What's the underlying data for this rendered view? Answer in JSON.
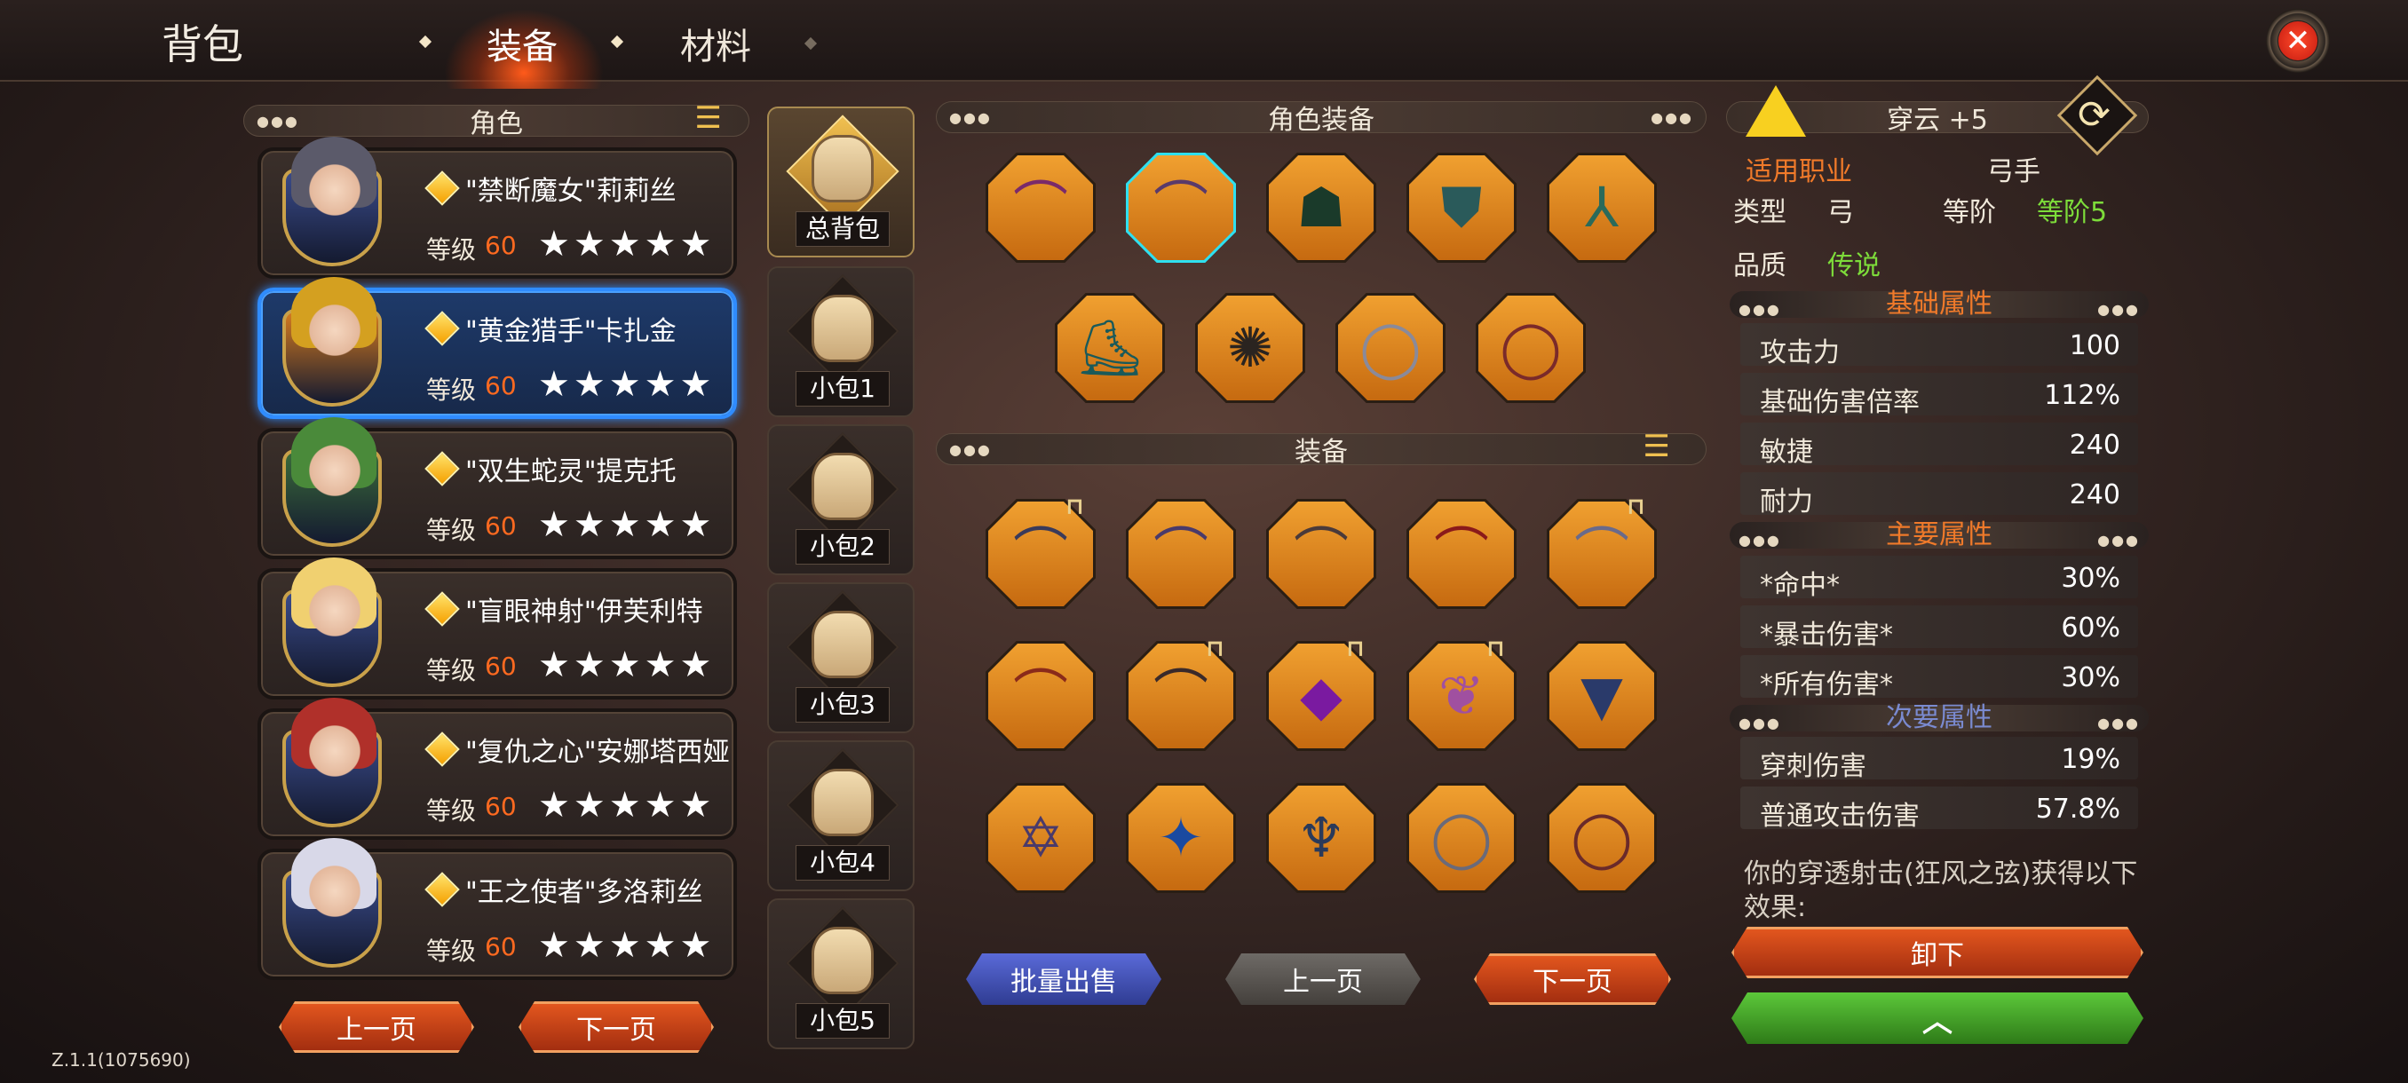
{
  "header": {
    "title": "背包",
    "tabs": [
      {
        "label": "装备",
        "active": true
      },
      {
        "label": "材料",
        "active": false
      }
    ]
  },
  "roles": {
    "header": "角色",
    "list": [
      {
        "name": "\"禁断魔女\"莉莉丝",
        "level_label": "等级",
        "level": "60",
        "stars": "★★★★★",
        "selected": false,
        "hair": "#5b5a6a",
        "shield": "#3a4b8a"
      },
      {
        "name": "\"黄金猎手\"卡扎金",
        "level_label": "等级",
        "level": "60",
        "stars": "★★★★★",
        "selected": true,
        "hair": "#d4a020",
        "shield": "#d47a20"
      },
      {
        "name": "\"双生蛇灵\"提克托",
        "level_label": "等级",
        "level": "60",
        "stars": "★★★★★",
        "selected": false,
        "hair": "#4a8a3a",
        "shield": "#3a6a3a"
      },
      {
        "name": "\"盲眼神射\"伊芙利特",
        "level_label": "等级",
        "level": "60",
        "stars": "★★★★★",
        "selected": false,
        "hair": "#f0d070",
        "shield": "#3a4b8a"
      },
      {
        "name": "\"复仇之心\"安娜塔西娅",
        "level_label": "等级",
        "level": "60",
        "stars": "★★★★★",
        "selected": false,
        "hair": "#b0302a",
        "shield": "#3a4b8a"
      },
      {
        "name": "\"王之使者\"多洛莉丝",
        "level_label": "等级",
        "level": "60",
        "stars": "★★★★★",
        "selected": false,
        "hair": "#d8d8e8",
        "shield": "#3a4b8a"
      }
    ],
    "prev_label": "上一页",
    "next_label": "下一页"
  },
  "bags": [
    {
      "label": "总背包",
      "active": true
    },
    {
      "label": "小包1",
      "active": false
    },
    {
      "label": "小包2",
      "active": false
    },
    {
      "label": "小包3",
      "active": false
    },
    {
      "label": "小包4",
      "active": false
    },
    {
      "label": "小包5",
      "active": false
    }
  ],
  "role_equipment": {
    "header": "角色装备",
    "row1": [
      {
        "icon": "bow-icon",
        "glyph": "⌒",
        "color": "#7a2a6a",
        "selected": false
      },
      {
        "icon": "bow-icon",
        "glyph": "⌒",
        "color": "#5a3a6a",
        "selected": true
      },
      {
        "icon": "hood-icon",
        "glyph": "☗",
        "color": "#1a3a2a",
        "selected": false
      },
      {
        "icon": "armor-icon",
        "glyph": "⛊",
        "color": "#2a5a5a",
        "selected": false
      },
      {
        "icon": "leggings-icon",
        "glyph": "⅄",
        "color": "#2a6a5a",
        "selected": false
      }
    ],
    "row2": [
      {
        "icon": "boots-icon",
        "glyph": "⛸",
        "color": "#1a5a5a",
        "selected": false
      },
      {
        "icon": "amulet-icon",
        "glyph": "✺",
        "color": "#2a2420",
        "selected": false
      },
      {
        "icon": "ring-icon",
        "glyph": "◯",
        "color": "#8a8a9a",
        "selected": false
      },
      {
        "icon": "ring-icon",
        "glyph": "◯",
        "color": "#7a2a2a",
        "selected": false
      }
    ]
  },
  "equipment": {
    "header": "装备",
    "items": [
      {
        "icon": "bow-icon",
        "glyph": "⌒",
        "color": "#3a3a5a",
        "locked": true
      },
      {
        "icon": "bow-icon",
        "glyph": "⌒",
        "color": "#4a3a6a",
        "locked": false
      },
      {
        "icon": "bow-icon",
        "glyph": "⌒",
        "color": "#4a3a3a",
        "locked": false
      },
      {
        "icon": "bow-icon",
        "glyph": "⌒",
        "color": "#8a1a1a",
        "locked": false
      },
      {
        "icon": "bow-icon",
        "glyph": "⌒",
        "color": "#6a6a8a",
        "locked": true
      },
      {
        "icon": "bow-icon",
        "glyph": "⌒",
        "color": "#8a2a1a",
        "locked": false
      },
      {
        "icon": "bow-icon",
        "glyph": "⌒",
        "color": "#3a2a2a",
        "locked": true
      },
      {
        "icon": "amulet-icon",
        "glyph": "◆",
        "color": "#7a1aa0",
        "locked": true
      },
      {
        "icon": "amulet-icon",
        "glyph": "❦",
        "color": "#a050a0",
        "locked": true
      },
      {
        "icon": "amulet-icon",
        "glyph": "▼",
        "color": "#2a3a6a",
        "locked": false
      },
      {
        "icon": "amulet-icon",
        "glyph": "✡",
        "color": "#4a3a6a",
        "locked": false
      },
      {
        "icon": "amulet-icon",
        "glyph": "✦",
        "color": "#1a4aa0",
        "locked": false
      },
      {
        "icon": "amulet-icon",
        "glyph": "♆",
        "color": "#2a3a5a",
        "locked": false
      },
      {
        "icon": "ring-icon",
        "glyph": "◯",
        "color": "#6a6a7a",
        "locked": false
      },
      {
        "icon": "ring-icon",
        "glyph": "◯",
        "color": "#6a2a2a",
        "locked": false
      }
    ],
    "bulk_sell_label": "批量出售",
    "prev_label": "上一页",
    "next_label": "下一页"
  },
  "detail": {
    "name": "穿云 +5",
    "class_label": "适用职业",
    "class_value": "弓手",
    "type_label": "类型",
    "type_value": "弓",
    "tier_label": "等阶",
    "tier_value": "等阶5",
    "quality_label": "品质",
    "quality_value": "传说",
    "base_header": "基础属性",
    "base_stats": [
      {
        "name": "攻击力",
        "value": "100"
      },
      {
        "name": "基础伤害倍率",
        "value": "112%"
      },
      {
        "name": "敏捷",
        "value": "240"
      },
      {
        "name": "耐力",
        "value": "240"
      }
    ],
    "main_header": "主要属性",
    "main_stats": [
      {
        "name": "*命中*",
        "value": "30%"
      },
      {
        "name": "*暴击伤害*",
        "value": "60%"
      },
      {
        "name": "*所有伤害*",
        "value": "30%"
      }
    ],
    "sub_header": "次要属性",
    "sub_stats": [
      {
        "name": "穿刺伤害",
        "value": "19%"
      },
      {
        "name": "普通攻击伤害",
        "value": "57.8%"
      }
    ],
    "effect_text": "你的穿透射击(狂风之弦)获得以下效果:",
    "unequip_label": "卸下",
    "upgrade_glyph": "︿"
  },
  "version": "Z.1.1(1075690)",
  "colors": {
    "accent_orange": "#ff6a20",
    "tier_green": "#7ddc3a",
    "quality_green": "#7ddc3a",
    "section_orange": "#f07a2a",
    "sub_blue": "#7a8ad0",
    "select_cyan": "#2ee0f0",
    "select_blue": "#2f8cff"
  }
}
